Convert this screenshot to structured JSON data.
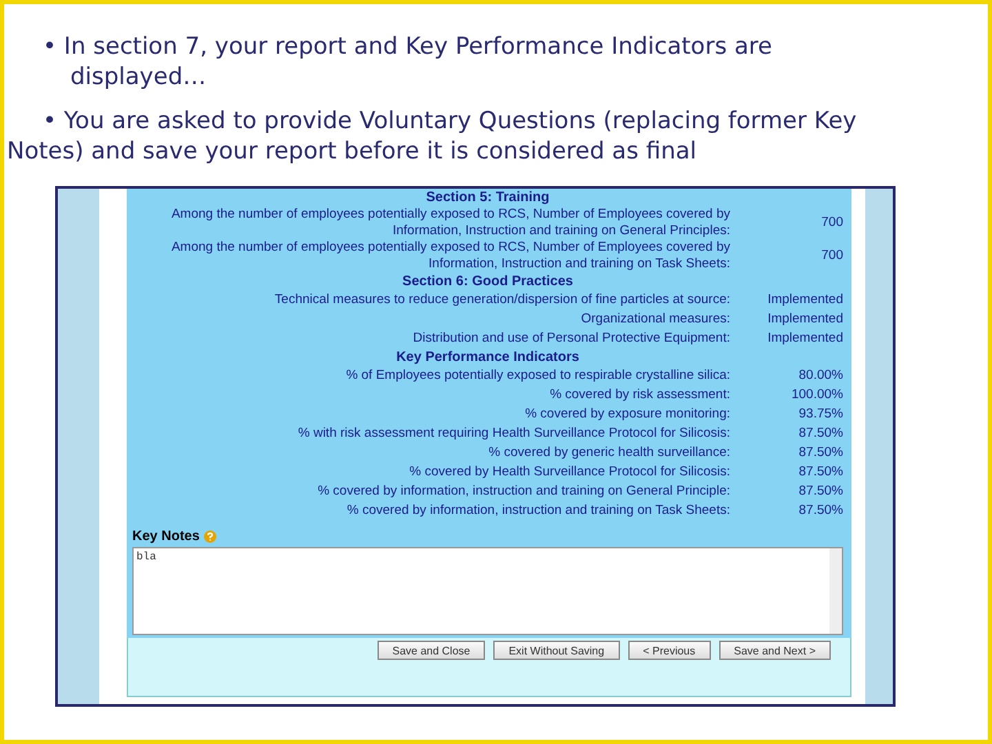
{
  "bullets": [
    "• In section 7, your report and Key Performance Indicators are displayed…",
    "• You are asked to provide Voluntary Questions (replacing former Key Notes) and save your report before it is considered as final"
  ],
  "report": {
    "rows": [
      {
        "kind": "heading",
        "label": "Section 5: Training"
      },
      {
        "kind": "value",
        "label": "Among the number of employees potentially exposed to RCS, Number of Employees covered by Information, Instruction and training on General Principles:",
        "value": "700"
      },
      {
        "kind": "value",
        "label": "Among the number of employees potentially exposed to RCS, Number of Employees covered by Information, Instruction and training on Task Sheets:",
        "value": "700"
      },
      {
        "kind": "heading",
        "label": "Section 6: Good Practices"
      },
      {
        "kind": "value",
        "label": "Technical measures to reduce generation/dispersion of fine particles at source:",
        "value": "Implemented"
      },
      {
        "kind": "value",
        "label": "Organizational measures:",
        "value": "Implemented"
      },
      {
        "kind": "value",
        "label": "Distribution and use of Personal Protective Equipment:",
        "value": "Implemented"
      },
      {
        "kind": "heading",
        "label": "Key Performance Indicators"
      },
      {
        "kind": "value",
        "label": "% of Employees potentially exposed to respirable crystalline silica:",
        "value": "80.00%"
      },
      {
        "kind": "value",
        "label": "% covered by risk assessment:",
        "value": "100.00%"
      },
      {
        "kind": "value",
        "label": "% covered by exposure monitoring:",
        "value": "93.75%"
      },
      {
        "kind": "value",
        "label": "% with risk assessment requiring Health Surveillance Protocol for Silicosis:",
        "value": "87.50%"
      },
      {
        "kind": "value",
        "label": "% covered by generic health surveillance:",
        "value": "87.50%"
      },
      {
        "kind": "value",
        "label": "% covered by Health Surveillance Protocol for Silicosis:",
        "value": "87.50%"
      },
      {
        "kind": "value",
        "label": "% covered by information, instruction and training on General Principle:",
        "value": "87.50%"
      },
      {
        "kind": "value",
        "label": "% covered by information, instruction and training on Task Sheets:",
        "value": "87.50%"
      }
    ],
    "key_notes": {
      "label": "Key Notes",
      "value": "bla"
    },
    "buttons": [
      "Save and Close",
      "Exit Without Saving",
      "< Previous",
      "Save and Next >"
    ]
  }
}
